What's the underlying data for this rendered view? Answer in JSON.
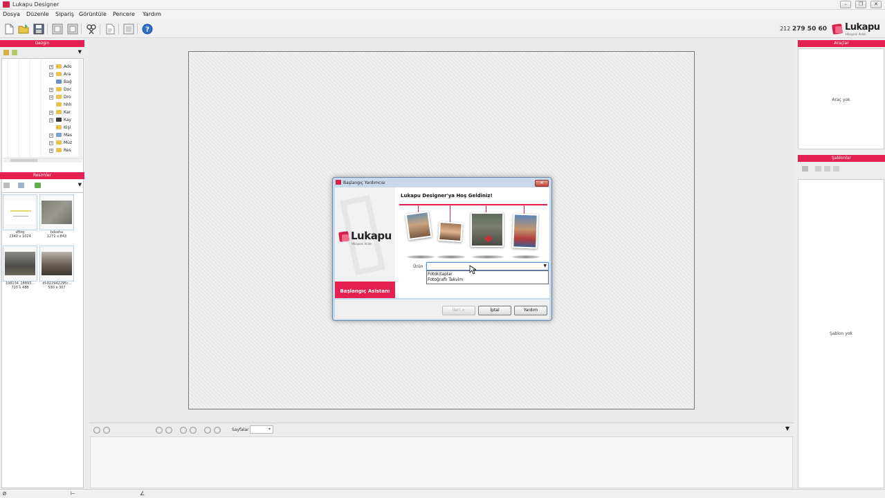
{
  "window": {
    "title": "Lukapu Designer",
    "buttons": [
      "–",
      "❐",
      "✕"
    ]
  },
  "menu": [
    "Dosya",
    "Düzenle",
    "Sipariş",
    "Görüntüle",
    "Pencere",
    "Yardım"
  ],
  "toolbar": {
    "phone_prefix": "212",
    "phone_number": "279 50 60",
    "brand": "Lukapu",
    "brand_sub": "Hikayeni Anlat",
    "icons": [
      "new-document-icon",
      "open-folder-icon",
      "save-icon",
      "undo-icon",
      "redo-icon",
      "tools-icon",
      "print-preview-icon",
      "layout-icon",
      "help-icon"
    ]
  },
  "left_panel": {
    "browse_header": "Gezgin",
    "images_header": "Resimler",
    "tree_items": [
      "Ado",
      "Ara",
      "Bağ",
      "Doc",
      "Dro",
      "hhh",
      "Kar",
      "Kay",
      "Kişi",
      "Mas",
      "Müz",
      "Res"
    ],
    "images": [
      {
        "name": "dfbig",
        "size": "2340 x 1024"
      },
      {
        "name": "hdzaha",
        "size": "1271 x 843"
      },
      {
        "name": "198134_18893...",
        "size": "720 x 488"
      },
      {
        "name": "df-022942295r...",
        "size": "530 x 307"
      }
    ]
  },
  "right_panel": {
    "tools_header": "Araçlar",
    "tools_empty": "Araç yok",
    "templates_header": "Şablonlar",
    "templates_empty": "Şablon yok"
  },
  "bottom_bar": {
    "pages_label": "Sayfalar",
    "pages_value": ""
  },
  "dialog": {
    "title": "Başlangıç Yardımcısı",
    "heading": "Lukapu Designer'ya Hoş Geldiniz!",
    "brand": "Lukapu",
    "brand_sub": "Hikayeni Anlat",
    "ribbon": "Başlangıç Asistanı",
    "product_label": "Ürün",
    "product_value": "",
    "options": [
      "Fotokitaplar",
      "Fotoğraflı Takvim"
    ],
    "buttons": {
      "next": "İleri >",
      "cancel": "İptal",
      "help": "Yardım"
    }
  },
  "colors": {
    "brand": "#e3204f",
    "dialog_frame": "#c9d9ec"
  }
}
